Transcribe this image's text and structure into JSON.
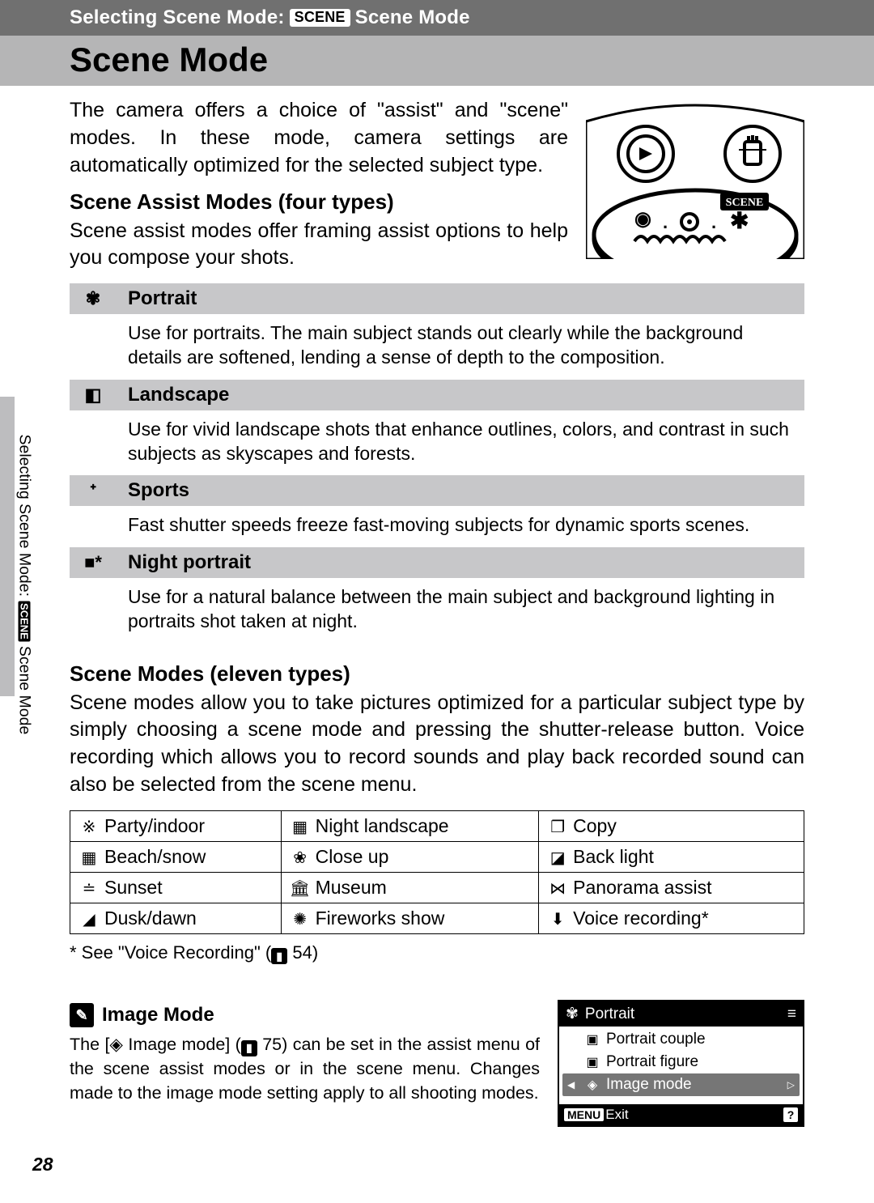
{
  "header": {
    "prefix": "Selecting Scene Mode:",
    "badge": "SCENE",
    "suffix": "Scene Mode"
  },
  "title": "Scene Mode",
  "intro": "The camera offers a choice of \"assist\" and \"scene\" modes. In these mode, camera settings are automatically optimized for the selected subject type.",
  "assist": {
    "heading": "Scene Assist Modes (four types)",
    "intro": "Scene assist modes offer framing assist options to help you compose your shots.",
    "rows": [
      {
        "icon": "✾",
        "name": "Portrait",
        "desc": "Use for portraits. The main subject stands out clearly while the background details are softened, lending a sense of depth to the composition."
      },
      {
        "icon": "◧",
        "name": "Landscape",
        "desc": "Use for vivid landscape shots that enhance outlines, colors, and contrast in such subjects as skyscapes and forests."
      },
      {
        "icon": "ᐩ",
        "name": "Sports",
        "desc": "Fast shutter speeds freeze fast-moving subjects for dynamic sports scenes."
      },
      {
        "icon": "■*",
        "name": "Night portrait",
        "desc": "Use for a natural balance between the main subject and background lighting in portraits shot taken at night."
      }
    ]
  },
  "scene": {
    "heading": "Scene Modes (eleven types)",
    "intro": "Scene modes allow you to take pictures optimized for a particular subject type by simply choosing a scene mode and pressing the shutter-release button. Voice recording which allows you to record sounds and play back recorded sound can also be selected from the scene menu.",
    "grid": [
      [
        {
          "icon": "※",
          "label": "Party/indoor"
        },
        {
          "icon": "▦",
          "label": "Night landscape"
        },
        {
          "icon": "❐",
          "label": "Copy"
        }
      ],
      [
        {
          "icon": "▦",
          "label": "Beach/snow"
        },
        {
          "icon": "❀",
          "label": "Close up"
        },
        {
          "icon": "◪",
          "label": "Back light"
        }
      ],
      [
        {
          "icon": "≐",
          "label": "Sunset"
        },
        {
          "icon": "🏛",
          "label": "Museum"
        },
        {
          "icon": "⋈",
          "label": "Panorama assist"
        }
      ],
      [
        {
          "icon": "◢",
          "label": "Dusk/dawn"
        },
        {
          "icon": "✺",
          "label": "Fireworks show"
        },
        {
          "icon": "⬇",
          "label": "Voice recording*"
        }
      ]
    ],
    "footnote_prefix": "* See \"Voice Recording\" (",
    "footnote_page": "54",
    "footnote_suffix": ")"
  },
  "note": {
    "title": "Image Mode",
    "text_a": "The [",
    "text_b": " Image mode] (",
    "text_c": " 75) can be set in the assist menu of the scene assist modes or in the scene menu. Changes made to the image mode setting apply to all shooting modes.",
    "imgmode_icon": "◈"
  },
  "menu": {
    "head": "Portrait",
    "items": [
      {
        "icon": "▣",
        "label": "Portrait couple"
      },
      {
        "icon": "▣",
        "label": "Portrait figure"
      },
      {
        "icon": "◈",
        "label": "Image mode",
        "selected": true
      }
    ],
    "foot_menu": "MENU",
    "foot_exit": "Exit",
    "foot_q": "?"
  },
  "side": {
    "prefix": "Selecting Scene Mode:",
    "badge": "SCENE",
    "suffix": "Scene Mode"
  },
  "pagenum": "28",
  "dial_label": "SCENE"
}
